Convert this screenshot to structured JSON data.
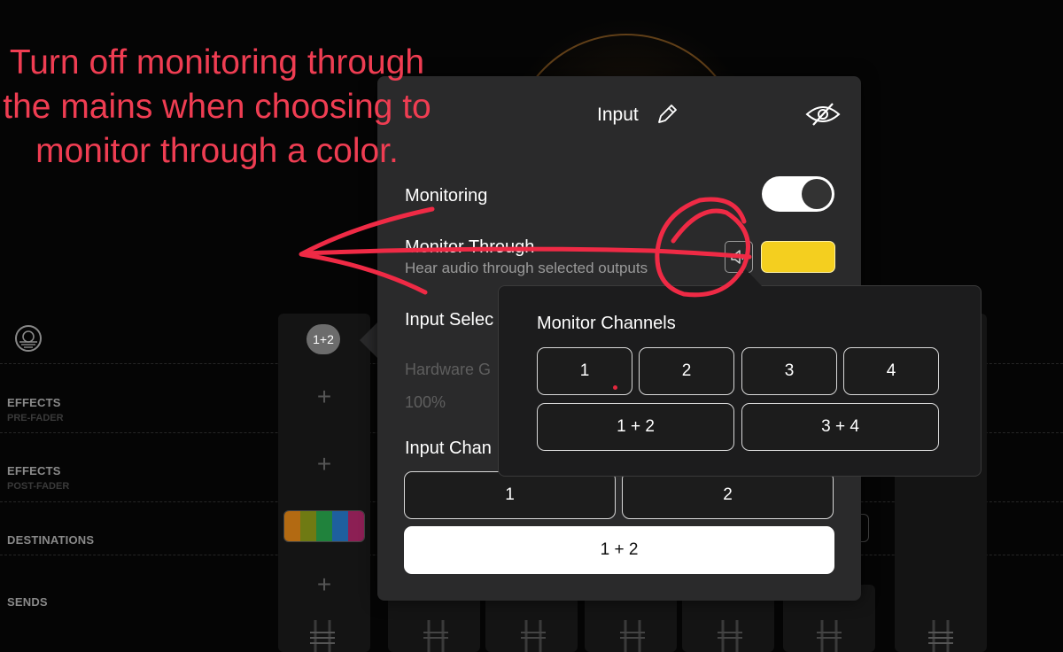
{
  "annotation": {
    "text": "Turn off monitoring through the mains when choosing to monitor through a color.",
    "color": "#ef3d52"
  },
  "mixer": {
    "rows": [
      {
        "label": "EFFECTS",
        "sublabel": "PRE-FADER"
      },
      {
        "label": "EFFECTS",
        "sublabel": "POST-FADER"
      },
      {
        "label": "DESTINATIONS",
        "sublabel": ""
      },
      {
        "label": "SENDS",
        "sublabel": ""
      }
    ],
    "channel_badge": "1+2",
    "plus_glyph": "+",
    "destination_colors": [
      "#b36a12",
      "#6f7a13",
      "#20823c",
      "#1e5f9e",
      "#8c1f54"
    ]
  },
  "input_popover": {
    "title": "Input",
    "monitoring_label": "Monitoring",
    "monitoring_on": true,
    "monitor_through_label": "Monitor Through",
    "monitor_through_subtitle": "Hear audio through selected outputs",
    "monitor_color": "#f4cf1f",
    "input_select_label": "Input Selec",
    "hardware_gain_label": "Hardware G",
    "hardware_gain_value": "100%",
    "input_channels_label": "Input Chan",
    "input_channels": [
      {
        "label": "1",
        "selected": false
      },
      {
        "label": "2",
        "selected": false
      },
      {
        "label": "1 + 2",
        "selected": true
      }
    ]
  },
  "monitor_channels_popover": {
    "title": "Monitor Channels",
    "row1": [
      "1",
      "2",
      "3",
      "4"
    ],
    "row2": [
      "1 + 2",
      "3 + 4"
    ]
  }
}
